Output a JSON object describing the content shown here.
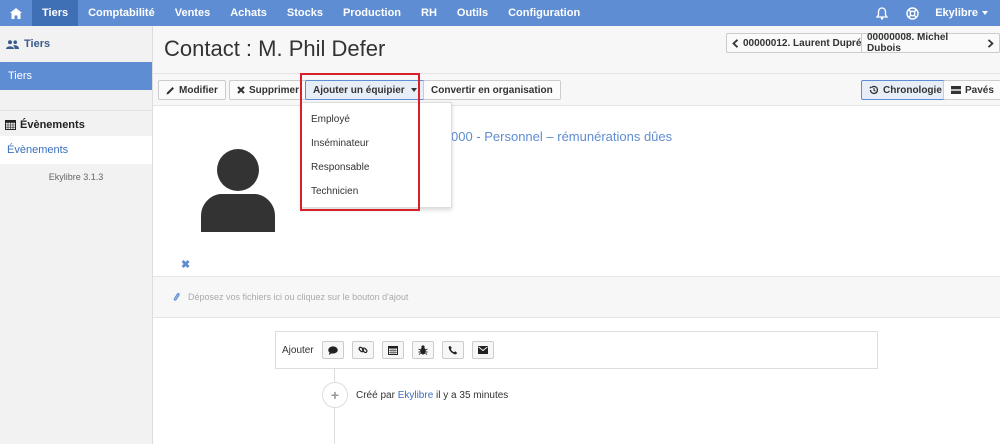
{
  "nav": {
    "items": [
      {
        "label": "Tiers",
        "active": true
      },
      {
        "label": "Comptabilité"
      },
      {
        "label": "Ventes"
      },
      {
        "label": "Achats"
      },
      {
        "label": "Stocks"
      },
      {
        "label": "Production"
      },
      {
        "label": "RH"
      },
      {
        "label": "Outils"
      },
      {
        "label": "Configuration"
      }
    ],
    "user": "Ekylibre"
  },
  "sidebar": {
    "section1": "Tiers",
    "section1_item": "Tiers",
    "section2": "Évènements",
    "section2_item": "Évènements",
    "version": "Ekylibre 3.1.3"
  },
  "page": {
    "title": "Contact : M. Phil Defer",
    "prev": "00000012. Laurent Dupré",
    "next": "00000008. Michel Dubois"
  },
  "toolbar": {
    "edit": "Modifier",
    "delete": "Supprimer",
    "add_team": "Ajouter un équipier",
    "convert": "Convertir en organisation",
    "timeline": "Chronologie",
    "tiles": "Pavés"
  },
  "dropdown": {
    "items": [
      "Employé",
      "Inséminateur",
      "Responsable",
      "Technicien"
    ]
  },
  "content": {
    "account": "000 - Personnel – rémunérations dûes",
    "dropzone": "Déposez vos fichiers ici ou cliquez sur le bouton d'ajout",
    "add_label": "Ajouter",
    "timeline_prefix": "Créé par",
    "timeline_user": "Ekylibre",
    "timeline_suffix": "il y a 35 minutes"
  },
  "colors": {
    "primary": "#5f8dd3",
    "highlight": "#d9202a"
  }
}
